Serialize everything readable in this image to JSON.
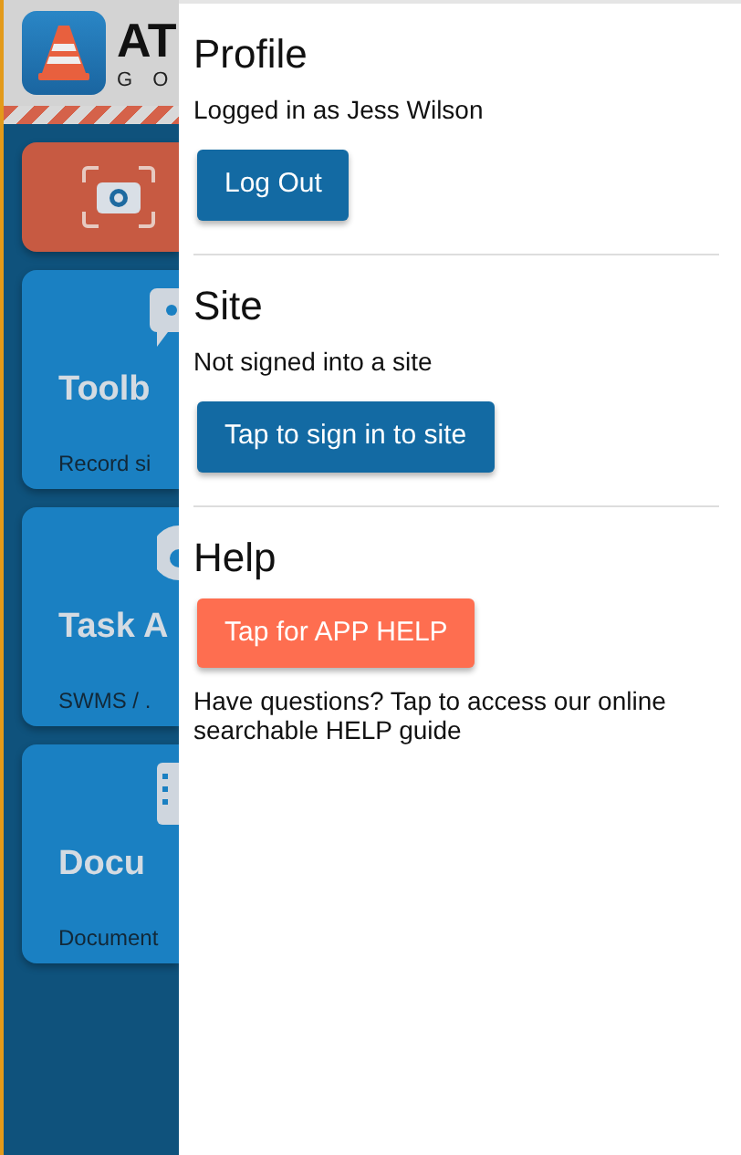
{
  "app_header": {
    "logo_title": "AT",
    "logo_subtitle": "G O"
  },
  "tiles": [
    {
      "kind": "camera"
    },
    {
      "kind": "chat",
      "title": "Toolb",
      "subtitle": "Record si"
    },
    {
      "kind": "task",
      "title": "Task A",
      "subtitle": "SWMS / ."
    },
    {
      "kind": "document",
      "title": "Docu",
      "subtitle": "Document"
    }
  ],
  "drawer": {
    "sections": [
      {
        "heading": "Profile",
        "items": [
          {
            "kind": "text",
            "text": "Logged in as Jess Wilson"
          },
          {
            "kind": "button",
            "label": "Log Out",
            "color": "#136aa3"
          }
        ]
      },
      {
        "heading": "Site",
        "items": [
          {
            "kind": "text",
            "text": "Not signed into a site"
          },
          {
            "kind": "button",
            "label": "Tap to sign in to site",
            "color": "#136aa3"
          }
        ]
      },
      {
        "heading": "Help",
        "items": [
          {
            "kind": "button",
            "label": "Tap for APP HELP",
            "color": "#fe6e50"
          },
          {
            "kind": "text",
            "text": "Have questions? Tap to access our online searchable HELP guide"
          }
        ]
      }
    ]
  }
}
